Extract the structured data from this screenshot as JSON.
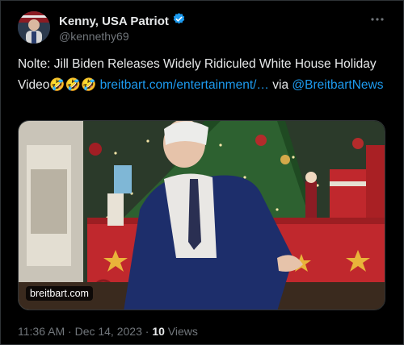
{
  "user": {
    "display_name": "Kenny, USA Patriot",
    "handle": "@kennethy69",
    "verified_icon": "verified-badge-icon",
    "avatar_icon": "avatar"
  },
  "tweet": {
    "text_line": "Nolte: Jill Biden Releases Widely Ridiculed White House Holiday Video",
    "emojis": "🤣🤣🤣",
    "link": "breitbart.com/entertainment/…",
    "via_word": "via",
    "mention": "@BreitbartNews"
  },
  "media": {
    "source_badge": "breitbart.com"
  },
  "meta": {
    "time": "11:36 AM",
    "separator": "·",
    "date": "Dec 14, 2023",
    "views_count": "10",
    "views_label": "Views"
  },
  "more_icon": "more-options-icon",
  "colors": {
    "background": "#000000",
    "text": "#e7e9ea",
    "muted": "#71767b",
    "link": "#1d9bf0"
  }
}
